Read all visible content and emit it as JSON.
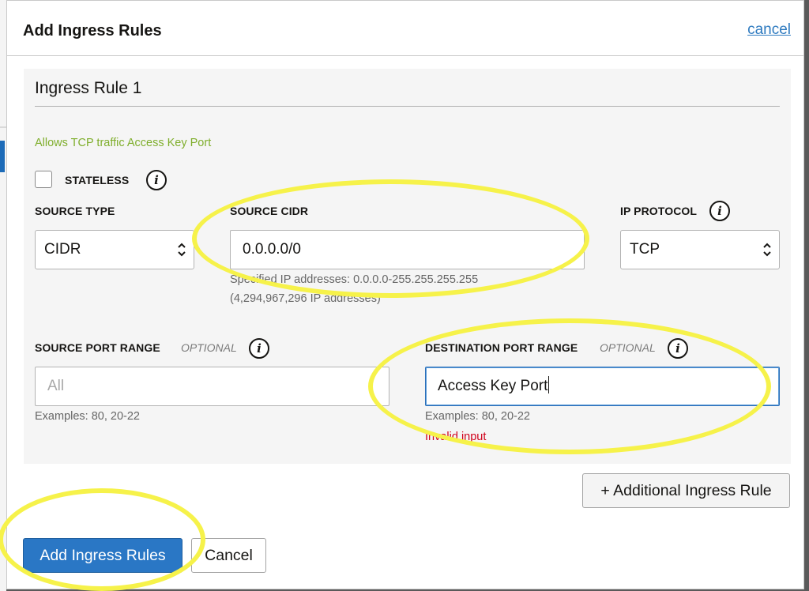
{
  "dialog": {
    "title": "Add Ingress Rules",
    "cancel_link": "cancel"
  },
  "rule": {
    "title": "Ingress Rule 1",
    "description": "Allows TCP traffic Access Key Port",
    "stateless_label": "STATELESS",
    "stateless_checked": false,
    "source_type": {
      "label": "SOURCE TYPE",
      "value": "CIDR"
    },
    "source_cidr": {
      "label": "SOURCE CIDR",
      "value": "0.0.0.0/0",
      "hint_line1": "Specified IP addresses: 0.0.0.0-255.255.255.255",
      "hint_line2": "(4,294,967,296 IP addresses)"
    },
    "ip_protocol": {
      "label": "IP PROTOCOL",
      "value": "TCP"
    },
    "source_port_range": {
      "label": "SOURCE PORT RANGE",
      "optional": "OPTIONAL",
      "placeholder": "All",
      "hint": "Examples: 80, 20-22"
    },
    "destination_port_range": {
      "label": "DESTINATION PORT RANGE",
      "optional": "OPTIONAL",
      "value": "Access Key Port",
      "hint": "Examples: 80, 20-22",
      "error": "Invalid input"
    }
  },
  "buttons": {
    "additional_rule": "+ Additional Ingress Rule",
    "add_rules": "Add Ingress Rules",
    "cancel": "Cancel"
  },
  "icons": {
    "info": "info-icon",
    "chevron": "up-down-chevron-icon"
  },
  "colors": {
    "primary": "#2a77c5",
    "link": "#2f7bc0",
    "description_green": "#7fae2c",
    "error": "#d0021b",
    "highlight": "#f6f24a"
  }
}
